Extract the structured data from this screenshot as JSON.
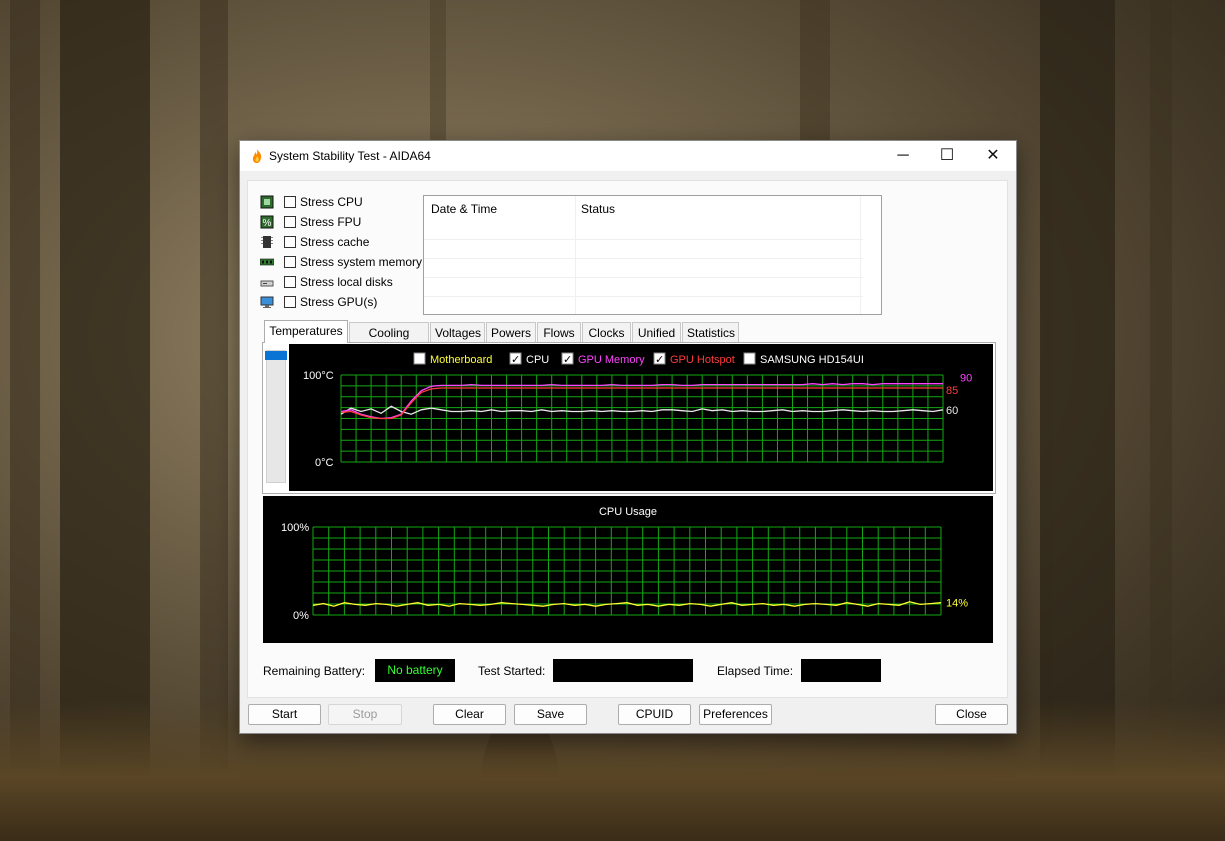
{
  "window": {
    "title": "System Stability Test - AIDA64",
    "minimize_glyph": "─",
    "maximize_glyph": "☐",
    "close_glyph": "✕"
  },
  "stress_options": [
    {
      "label": "Stress CPU",
      "checked": false,
      "icon": "cpu-chip-icon"
    },
    {
      "label": "Stress FPU",
      "checked": false,
      "icon": "fpu-percent-icon"
    },
    {
      "label": "Stress cache",
      "checked": false,
      "icon": "cache-chip-icon"
    },
    {
      "label": "Stress system memory",
      "checked": false,
      "icon": "memory-module-icon"
    },
    {
      "label": "Stress local disks",
      "checked": false,
      "icon": "hard-disk-icon"
    },
    {
      "label": "Stress GPU(s)",
      "checked": false,
      "icon": "gpu-monitor-icon"
    }
  ],
  "log": {
    "columns": [
      "Date & Time",
      "Status"
    ],
    "rows": []
  },
  "tabs": [
    "Temperatures",
    "Cooling Fans",
    "Voltages",
    "Powers",
    "Flows",
    "Clocks",
    "Unified",
    "Statistics"
  ],
  "active_tab": "Temperatures",
  "legend": [
    {
      "label": "Motherboard",
      "checked": false,
      "color": "#ffff33"
    },
    {
      "label": "CPU",
      "checked": true,
      "color": "#ffffff"
    },
    {
      "label": "GPU Memory",
      "checked": true,
      "color": "#ff44ff"
    },
    {
      "label": "GPU Hotspot",
      "checked": true,
      "color": "#ff3b3b"
    },
    {
      "label": "SAMSUNG HD154UI",
      "checked": false,
      "color": "#ffffff"
    }
  ],
  "colors": {
    "grid": "#13a813",
    "cpu_usage": "#ffff33",
    "battery_text": "#33ff33"
  },
  "chart_data": [
    {
      "type": "line",
      "title": "",
      "ylabel": "",
      "y_top_label": "100°C",
      "y_bottom_label": "0°C",
      "ylim": [
        0,
        100
      ],
      "series": [
        {
          "name": "CPU",
          "color": "#e8e8e8",
          "end_label": "60",
          "values": [
            55,
            62,
            58,
            61,
            56,
            64,
            58,
            55,
            60,
            62,
            60,
            58,
            58,
            59,
            58,
            60,
            58,
            59,
            59,
            58,
            60,
            58,
            59,
            58,
            58,
            59,
            58,
            59,
            58,
            58,
            59,
            58,
            60,
            60,
            59,
            58,
            61,
            59,
            60,
            58,
            59,
            58,
            58,
            59,
            60,
            58,
            59,
            58,
            58,
            59,
            60,
            59,
            58,
            59,
            58,
            58,
            59,
            60,
            59,
            58,
            60
          ]
        },
        {
          "name": "GPU Memory",
          "color": "#ff44ff",
          "end_label": "90",
          "values": [
            58,
            60,
            55,
            52,
            50,
            51,
            55,
            70,
            82,
            87,
            88,
            88,
            88,
            89,
            88,
            88,
            88,
            88,
            88,
            88,
            88,
            89,
            88,
            88,
            88,
            88,
            88,
            89,
            88,
            88,
            88,
            88,
            89,
            89,
            88,
            88,
            89,
            89,
            89,
            89,
            89,
            89,
            89,
            89,
            89,
            89,
            89,
            90,
            89,
            90,
            89,
            90,
            90,
            89,
            90,
            90,
            90,
            90,
            90,
            90,
            90
          ]
        },
        {
          "name": "GPU Hotspot",
          "color": "#ff3b3b",
          "end_label": "85",
          "values": [
            57,
            58,
            54,
            51,
            50,
            50,
            54,
            68,
            80,
            84,
            85,
            85,
            85,
            85,
            85,
            85,
            85,
            85,
            85,
            85,
            85,
            85,
            85,
            85,
            85,
            85,
            85,
            85,
            85,
            85,
            85,
            85,
            85,
            85,
            85,
            85,
            85,
            85,
            85,
            85,
            85,
            85,
            85,
            85,
            85,
            85,
            85,
            85,
            85,
            85,
            85,
            85,
            85,
            85,
            85,
            85,
            85,
            85,
            85,
            85,
            85
          ]
        }
      ]
    },
    {
      "type": "line",
      "title": "CPU Usage",
      "ylabel": "",
      "y_top_label": "100%",
      "y_bottom_label": "0%",
      "ylim": [
        0,
        100
      ],
      "series": [
        {
          "name": "",
          "color": "#ffff33",
          "end_label": "14%",
          "values": [
            11,
            13,
            10,
            14,
            12,
            11,
            13,
            12,
            10,
            12,
            14,
            11,
            12,
            10,
            13,
            12,
            11,
            12,
            14,
            13,
            12,
            11,
            10,
            12,
            13,
            11,
            12,
            10,
            12,
            13,
            14,
            11,
            12,
            10,
            12,
            11,
            13,
            12,
            10,
            12,
            14,
            11,
            12,
            13,
            11,
            12,
            10,
            12,
            13,
            12,
            11,
            14,
            12,
            10,
            13,
            12,
            11,
            15,
            12,
            13,
            14
          ]
        }
      ]
    }
  ],
  "footer": {
    "battery_label": "Remaining Battery:",
    "battery_value": "No battery",
    "started_label": "Test Started:",
    "started_value": "",
    "elapsed_label": "Elapsed Time:",
    "elapsed_value": ""
  },
  "buttons": {
    "start": "Start",
    "stop": "Stop",
    "clear": "Clear",
    "save": "Save",
    "cpuid": "CPUID",
    "preferences": "Preferences",
    "close": "Close"
  }
}
